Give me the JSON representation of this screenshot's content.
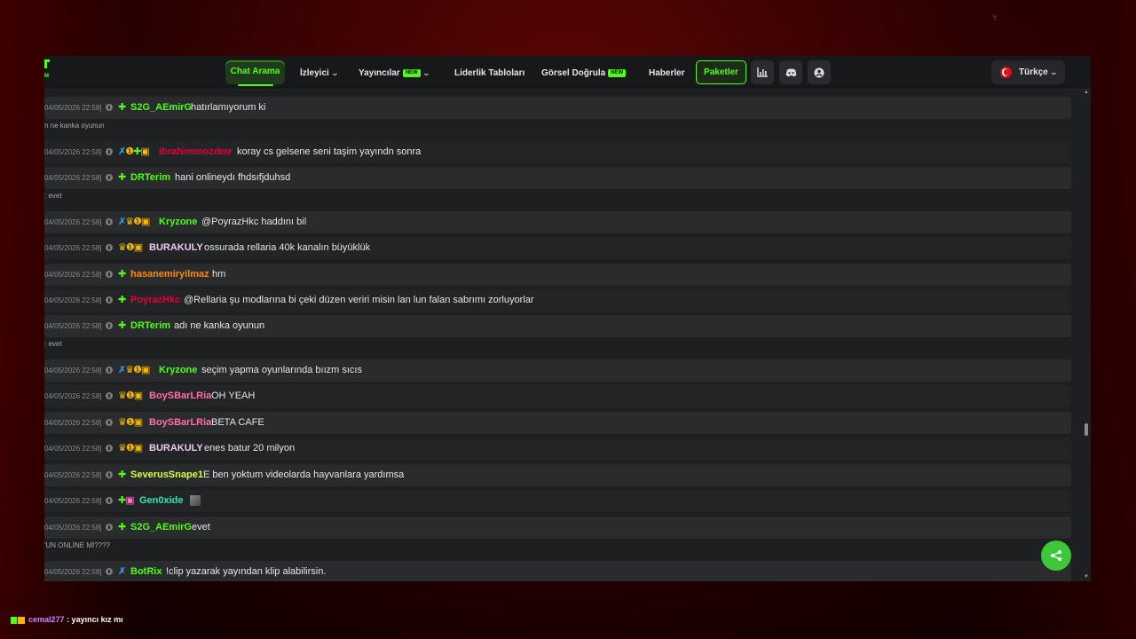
{
  "background_mark": "Y",
  "nav": {
    "items": [
      {
        "label": "Chat Arama",
        "active": true
      },
      {
        "label": "İzleyici",
        "dropdown": true
      },
      {
        "label": "Yayıncılar",
        "badge": "NEW",
        "dropdown": true
      },
      {
        "label": "Liderlik Tabloları"
      },
      {
        "label": "Görsel Doğrula",
        "badge": "NEW"
      },
      {
        "label": "Haberler"
      }
    ],
    "paket_label": "Paketler",
    "icons": [
      "stats-icon",
      "discord-icon",
      "account-icon"
    ],
    "language": "Türkçe"
  },
  "colors": {
    "accent": "#53fc18",
    "share": "#3dc83a"
  },
  "messages": [
    {
      "ts": "04/05/2026 22:58]",
      "badges": "green",
      "user": "S2G_AEmirG",
      "color": "#53fc18",
      "text": "hatırlamıyorum ki"
    },
    {
      "reply": "n ne kanka oyunun"
    },
    {
      "ts": "04/05/2026 22:58]",
      "badges": "blue-gold-green-gold",
      "user": "ibrahimmozdmr",
      "color": "#e0003c",
      "text": "koray cs gelsene seni taşim yayındn sonra"
    },
    {
      "ts": "04/05/2026 22:58]",
      "badges": "green",
      "user": "DRTerim",
      "color": "#53fc18",
      "text": "hani onlineydı fhdsıfjduhsd"
    },
    {
      "reply": ": evet"
    },
    {
      "ts": "04/05/2026 22:58]",
      "badges": "blue-gold",
      "user": "Kryzone",
      "color": "#53fc18",
      "text": "@PoyrazHkc haddını bil"
    },
    {
      "ts": "04/05/2026 22:58]",
      "badges": "gold",
      "user": "BURAKULY",
      "color": "#f0c8f0",
      "text": "ossurada rellaria 40k kanalın büyüklük"
    },
    {
      "ts": "04/05/2026 22:58]",
      "badges": "green",
      "user": "hasanemiryilmaz",
      "color": "#ff8a00",
      "text": "hm"
    },
    {
      "ts": "04/05/2026 22:58]",
      "badges": "green",
      "user": "PoyrazHkc",
      "color": "#e0003c",
      "text": "@Rellaria şu modlarına bi çeki düzen veriri misin lan lun falan sabrımı zorluyorlar"
    },
    {
      "ts": "04/05/2026 22:58]",
      "badges": "green",
      "user": "DRTerim",
      "color": "#53fc18",
      "text": "adı ne kanka oyunun"
    },
    {
      "reply": ": evet"
    },
    {
      "ts": "04/05/2026 22:58]",
      "badges": "blue-gold",
      "user": "Kryzone",
      "color": "#53fc18",
      "text": "seçim yapma oyunlarında bıızm sıcıs"
    },
    {
      "ts": "04/05/2026 22:58]",
      "badges": "gold",
      "user": "BoySBarLRia",
      "color": "#ff6fa8",
      "text": "OH YEAH"
    },
    {
      "ts": "04/05/2026 22:58]",
      "badges": "gold",
      "user": "BoySBarLRia",
      "color": "#ff6fa8",
      "text": "BETA CAFE"
    },
    {
      "ts": "04/05/2026 22:58]",
      "badges": "gold",
      "user": "BURAKULY",
      "color": "#f0c8f0",
      "text": "enes batur 20 milyon"
    },
    {
      "ts": "04/05/2026 22:58]",
      "badges": "green",
      "user": "SeverusSnape1",
      "color": "#d7ff3a",
      "text": "E ben yoktum videolarda hayvanlara yardımsa"
    },
    {
      "ts": "04/05/2026 22:58]",
      "badges": "green-pink",
      "user": "Gen0xide",
      "color": "#2ee6b4",
      "text": "",
      "emote": true
    },
    {
      "ts": "04/05/2026 22:58]",
      "badges": "green",
      "user": "S2G_AEmirG",
      "color": "#53fc18",
      "text": "evet"
    },
    {
      "reply": "'UN ONLİNE Mİ????"
    },
    {
      "ts": "04/05/2026 22:58]",
      "badges": "blue",
      "user": "BotRix",
      "color": "#53fc18",
      "text": "!clip yazarak yayından klip alabilirsin."
    }
  ],
  "bottom_chat": {
    "user": "cemal277",
    "text": ": yayıncı kız mı"
  }
}
